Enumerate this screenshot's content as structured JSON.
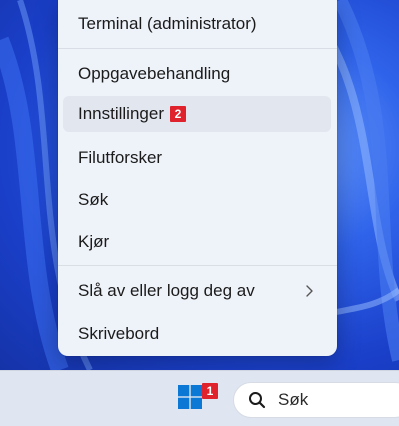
{
  "context_menu": {
    "items": [
      {
        "label": "Terminal (administrator)"
      },
      {
        "label": "Oppgavebehandling"
      },
      {
        "label": "Innstillinger",
        "badge": "2"
      },
      {
        "label": "Filutforsker"
      },
      {
        "label": "Søk"
      },
      {
        "label": "Kjør"
      },
      {
        "label": "Slå av eller logg deg av",
        "icon": "chevron-right-icon"
      },
      {
        "label": "Skrivebord"
      }
    ],
    "highlighted_item": "Innstillinger"
  },
  "taskbar": {
    "start_button": {
      "icon": "windows-logo-icon",
      "badge": "1"
    },
    "search": {
      "label": "Søk",
      "icon": "search-icon"
    }
  },
  "colors": {
    "menu_bg": "#eef2f9",
    "hover_bg": "#e2e6ef",
    "badge_red": "#e0222c",
    "windows_blue": "#0a78d4",
    "taskbar_bg": "#dfe6f1"
  }
}
